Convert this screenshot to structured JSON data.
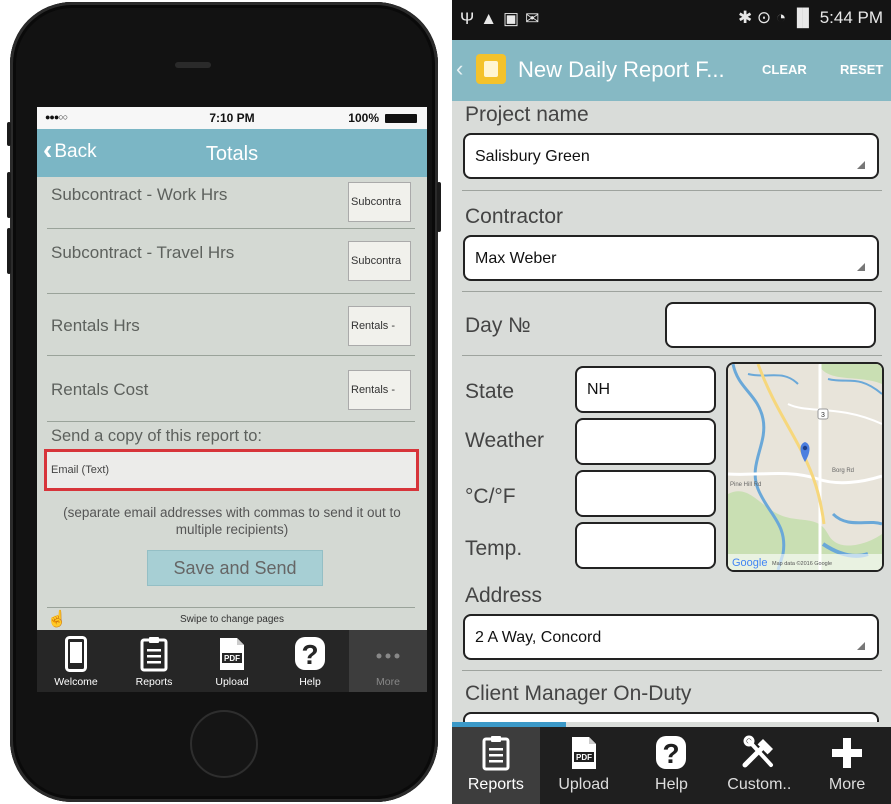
{
  "ios": {
    "status": {
      "signal": "●●●○○",
      "time": "7:10 PM",
      "battery": "100%"
    },
    "nav": {
      "back_label": "Back",
      "title": "Totals"
    },
    "rows": [
      {
        "label": "Subcontract - Work Hrs",
        "value": "Subcontra"
      },
      {
        "label": "Subcontract - Travel Hrs",
        "value": "Subcontra"
      },
      {
        "label": "Rentals Hrs",
        "value": "Rentals -"
      },
      {
        "label": "Rentals Cost",
        "value": "Rentals -"
      }
    ],
    "copy_label": "Send a copy of this report to:",
    "email_placeholder": "Email (Text)",
    "hint": "(separate email addresses with commas to send it out to multiple recipients)",
    "save_button": "Save and Send",
    "swipe_hint": "Swipe to change pages",
    "tabs": [
      {
        "label": "Welcome",
        "icon": "phone-icon"
      },
      {
        "label": "Reports",
        "icon": "clipboard-icon"
      },
      {
        "label": "Upload",
        "icon": "pdf-icon"
      },
      {
        "label": "Help",
        "icon": "question-icon"
      },
      {
        "label": "More",
        "icon": "ellipsis-icon"
      }
    ],
    "colors": {
      "nav": "#7bb6c5",
      "highlight": "#d7343a"
    }
  },
  "android": {
    "status": {
      "time": "5:44 PM"
    },
    "toolbar": {
      "title": "New Daily Report F...",
      "clear": "CLEAR",
      "reset": "RESET"
    },
    "fields": {
      "project_name_label": "Project name",
      "project_name_value": "Salisbury Green",
      "contractor_label": "Contractor",
      "contractor_value": "Max Weber",
      "day_label": "Day №",
      "day_value": "",
      "state_label": "State",
      "state_value": "NH",
      "weather_label": "Weather",
      "weather_value": "",
      "unit_label": "°C/°F",
      "unit_value": "",
      "temp_label": "Temp.",
      "temp_value": "",
      "address_label": "Address",
      "address_value": "2 A Way, Concord",
      "client_manager_label": "Client Manager On-Duty"
    },
    "map": {
      "brand": "Google",
      "attribution": "Map data ©2016 Google",
      "road_label_1": "Pine Hill Rd",
      "road_label_2": "Borg Rd",
      "route_badge": "3"
    },
    "tabs": [
      {
        "label": "Reports",
        "icon": "clipboard-icon"
      },
      {
        "label": "Upload",
        "icon": "pdf-icon"
      },
      {
        "label": "Help",
        "icon": "question-icon"
      },
      {
        "label": "Custom..",
        "icon": "tools-icon"
      },
      {
        "label": "More",
        "icon": "plus-icon"
      }
    ],
    "progress": 0.26,
    "colors": {
      "toolbar": "#86b9c4",
      "progress": "#3b99c8"
    }
  }
}
